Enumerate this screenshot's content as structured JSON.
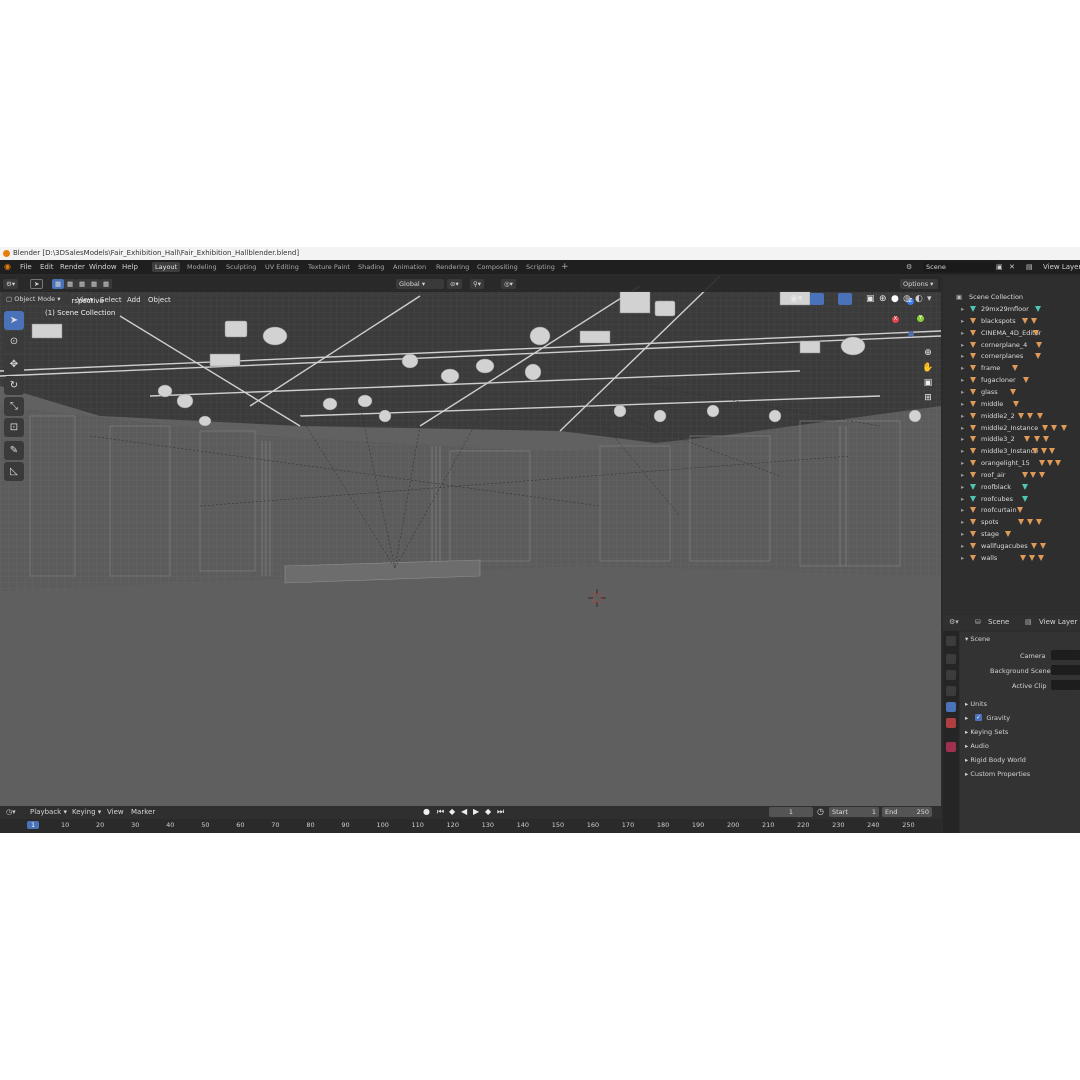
{
  "window": {
    "title": "Blender [D:\\3DSalesModels\\Fair_Exhibition_Hall\\Fair_Exhibition_Hallblender.blend]"
  },
  "menu": [
    "File",
    "Edit",
    "Render",
    "Window",
    "Help"
  ],
  "workspaces": [
    "Layout",
    "Modeling",
    "Sculpting",
    "UV Editing",
    "Texture Paint",
    "Shading",
    "Animation",
    "Rendering",
    "Compositing",
    "Scripting"
  ],
  "active_workspace": "Layout",
  "topright": {
    "scene": "Scene",
    "view_layer": "View Layer"
  },
  "viewport": {
    "mode": "Object Mode",
    "menus": [
      "View",
      "Select",
      "Add",
      "Object"
    ],
    "transform_orientation": "Global",
    "options": "Options",
    "overlay_title": "User Perspective",
    "overlay_collection": "(1) Scene Collection",
    "gizmo": {
      "x": "X",
      "y": "Y",
      "z": "Z"
    }
  },
  "outliner": {
    "root": "Scene Collection",
    "items": [
      {
        "name": "29mx29mfloor",
        "icon": "teal-mesh-icon"
      },
      {
        "name": "blackspots",
        "icon": "orange-mesh-icon"
      },
      {
        "name": "CINEMA_4D_Editor",
        "icon": "camera-icon"
      },
      {
        "name": "cornerplane_4",
        "icon": "orange-mesh-icon"
      },
      {
        "name": "cornerplanes",
        "icon": "orange-mesh-icon"
      },
      {
        "name": "frame",
        "icon": "orange-mesh-icon"
      },
      {
        "name": "fugacloner",
        "icon": "orange-mesh-icon"
      },
      {
        "name": "glass",
        "icon": "orange-mesh-icon"
      },
      {
        "name": "middle",
        "icon": "orange-mesh-icon"
      },
      {
        "name": "middle2_2",
        "icon": "orange-mesh-icon"
      },
      {
        "name": "middle2_Instance",
        "icon": "orange-mesh-icon"
      },
      {
        "name": "middle3_2",
        "icon": "orange-mesh-icon"
      },
      {
        "name": "middle3_Instance",
        "icon": "orange-mesh-icon"
      },
      {
        "name": "orangelight_15",
        "icon": "orange-mesh-icon"
      },
      {
        "name": "roof_air",
        "icon": "orange-mesh-icon"
      },
      {
        "name": "roofblack",
        "icon": "teal-mesh-icon"
      },
      {
        "name": "roofcubes",
        "icon": "teal-mesh-icon"
      },
      {
        "name": "roofcurtain",
        "icon": "orange-mesh-icon"
      },
      {
        "name": "spots",
        "icon": "orange-mesh-icon"
      },
      {
        "name": "stage",
        "icon": "orange-mesh-icon"
      },
      {
        "name": "wallfugacubes",
        "icon": "orange-mesh-icon"
      },
      {
        "name": "walls",
        "icon": "orange-mesh-icon"
      }
    ]
  },
  "properties": {
    "header_scene": "Scene",
    "header_view_layer": "View Layer",
    "panel": "Scene",
    "fields": [
      "Camera",
      "Background Scene",
      "Active Clip"
    ],
    "sections": [
      "Units",
      "Gravity",
      "Keying Sets",
      "Audio",
      "Rigid Body World",
      "Custom Properties"
    ],
    "gravity_checked": true
  },
  "timeline": {
    "menus": [
      "Playback",
      "Keying",
      "View",
      "Marker"
    ],
    "current_frame": "1",
    "start_label": "Start",
    "start": "1",
    "end_label": "End",
    "end": "250",
    "ruler": [
      "1",
      "10",
      "20",
      "30",
      "40",
      "50",
      "60",
      "70",
      "80",
      "90",
      "100",
      "110",
      "120",
      "130",
      "140",
      "150",
      "160",
      "170",
      "180",
      "190",
      "200",
      "210",
      "220",
      "230",
      "240",
      "250"
    ]
  },
  "colors": {
    "accent": "#4a72b8",
    "ui_bg": "#2b2b2b",
    "viewport_bg": "#616161",
    "mesh_orange": "#e09a57",
    "mesh_teal": "#4fc5b4",
    "axis_x": "#e8454f",
    "axis_y": "#8bd13b",
    "axis_z": "#3d7ee8"
  }
}
